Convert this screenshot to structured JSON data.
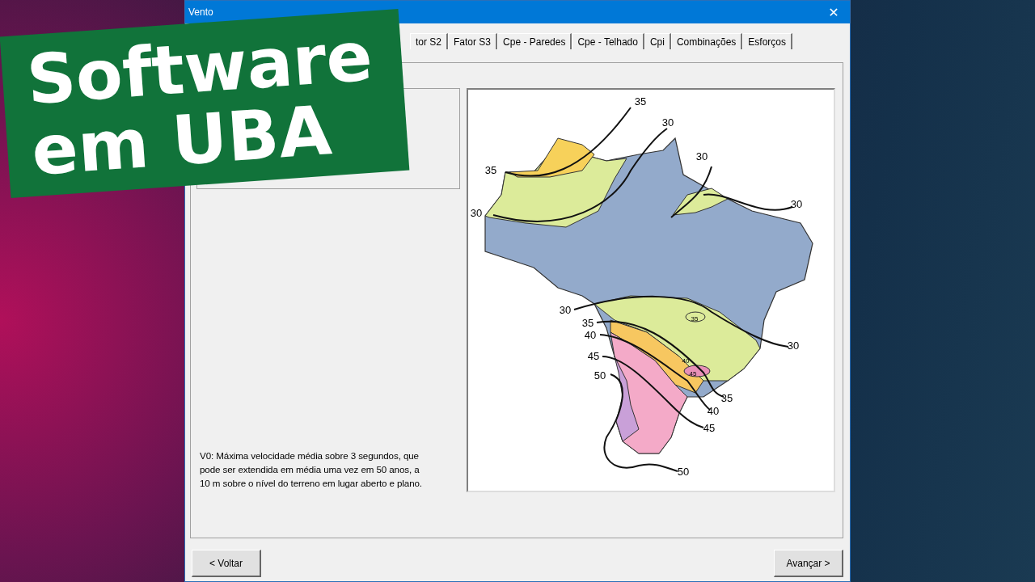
{
  "banner": {
    "lines": [
      "Software",
      "em UBA"
    ]
  },
  "window": {
    "title": "Vento",
    "close": "✕"
  },
  "tabs": [
    {
      "label": "tor S2",
      "selected": false
    },
    {
      "label": "Fator S3",
      "selected": false
    },
    {
      "label": "Cpe - Paredes",
      "selected": false
    },
    {
      "label": "Cpe - Telhado",
      "selected": false
    },
    {
      "label": "Cpi",
      "selected": false
    },
    {
      "label": "Combinações",
      "selected": false
    },
    {
      "label": "Esforços",
      "selected": false
    }
  ],
  "description": "V0: Máxima velocidade média sobre 3 segundos, que        pode ser extendida em média uma vez em 50 anos, a 10 m sobre o nível do terreno em lugar aberto e plano.",
  "map": {
    "labels": [
      "35",
      "30",
      "35",
      "30",
      "30",
      "30",
      "35",
      "30",
      "35",
      "40",
      "45",
      "40",
      "45",
      "50",
      "30",
      "35",
      "40",
      "45",
      "50"
    ]
  },
  "buttons": [
    {
      "label": "< Voltar"
    },
    {
      "label": "Avançar >"
    }
  ]
}
